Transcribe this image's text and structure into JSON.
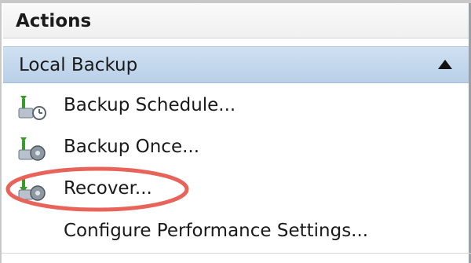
{
  "panel": {
    "title": "Actions"
  },
  "group": {
    "title": "Local Backup",
    "collapse_icon": "triangle-up-icon"
  },
  "items": [
    {
      "label": "Backup Schedule...",
      "icon": "backup-schedule-icon"
    },
    {
      "label": "Backup Once...",
      "icon": "backup-once-icon"
    },
    {
      "label": "Recover...",
      "icon": "recover-icon"
    },
    {
      "label": "Configure Performance Settings...",
      "icon": ""
    }
  ],
  "annotation": {
    "target": "Recover...",
    "color": "#e8645a"
  }
}
